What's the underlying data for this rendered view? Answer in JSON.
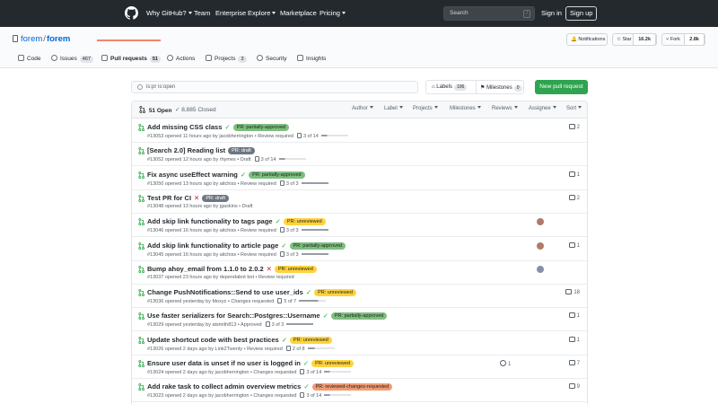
{
  "colors": {
    "header_bg": "#24292e",
    "accent": "#0366d6",
    "open_green": "#28a745",
    "new_pr_green": "#2ea44f",
    "fail_red": "#cb2431",
    "tab_underline": "#f9826c"
  },
  "header": {
    "logo_icon": "github-logo-icon",
    "nav": [
      "Why GitHub?",
      "Team",
      "Enterprise",
      "Explore",
      "Marketplace",
      "Pricing"
    ],
    "search_placeholder": "Search",
    "search_shortcut": "/",
    "sign_in": "Sign in",
    "sign_up": "Sign up"
  },
  "repo": {
    "owner": "forem",
    "separator": "/",
    "name": "forem",
    "notifications_label": "Notifications",
    "star_label": "Star",
    "star_count": "16.2k",
    "fork_label": "Fork",
    "fork_count": "2.8k"
  },
  "tabs": [
    {
      "label": "Code",
      "icon": "code-icon"
    },
    {
      "label": "Issues",
      "count": "467",
      "icon": "issue-icon"
    },
    {
      "label": "Pull requests",
      "count": "51",
      "icon": "pull-request-icon",
      "selected": true
    },
    {
      "label": "Actions",
      "icon": "play-icon"
    },
    {
      "label": "Projects",
      "count": "3",
      "icon": "project-icon"
    },
    {
      "label": "Security",
      "icon": "shield-icon"
    },
    {
      "label": "Insights",
      "icon": "graph-icon"
    }
  ],
  "toolbar": {
    "filter_value": "is:pr is:open",
    "labels_label": "Labels",
    "labels_count": "106",
    "milestones_label": "Milestones",
    "milestones_count": "0",
    "new_pr_label": "New pull request"
  },
  "list_header": {
    "open_label": "51 Open",
    "closed_label": "8,885 Closed",
    "filters": [
      "Author",
      "Label",
      "Projects",
      "Milestones",
      "Reviews",
      "Assignee",
      "Sort"
    ]
  },
  "label_colors": {
    "PR: partially-approved": {
      "bg": "#7dbf7d",
      "fg": "#1b1f23"
    },
    "PR: draft": {
      "bg": "#6e7781",
      "fg": "#ffffff"
    },
    "PR: unreviewed": {
      "bg": "#ffd33d",
      "fg": "#1b1f23"
    },
    "PR: reviewed-changes-requested": {
      "bg": "#f09b73",
      "fg": "#1b1f23"
    }
  },
  "pull_requests": [
    {
      "title": "Add missing CSS class",
      "status": "success",
      "label": "PR: partially-approved",
      "meta": "#13053 opened 11 hours ago by jacobherrington • Review required",
      "tasks": "3 of 14",
      "comments": "2"
    },
    {
      "title": "[Search 2.0] Reading list",
      "status": "none",
      "label": "PR: draft",
      "meta": "#13052 opened 12 hours ago by rhymes • Draft",
      "tasks": "3 of 14",
      "comments": ""
    },
    {
      "title": "Fix async useEffect warning",
      "status": "success",
      "label": "PR: partially-approved",
      "meta": "#13050 opened 13 hours ago by aitchiss • Review required",
      "tasks": "3 of 3",
      "comments": "1"
    },
    {
      "title": "Test PR for CI",
      "status": "fail",
      "label": "PR: draft",
      "meta": "#13048 opened 13 hours ago by jgaskins • Draft",
      "tasks": "",
      "comments": "2"
    },
    {
      "title": "Add skip link functionality to tags page",
      "status": "success",
      "label": "PR: unreviewed",
      "meta": "#13046 opened 16 hours ago by aitchiss • Review required",
      "tasks": "3 of 3",
      "comments": "",
      "avatar": "#b07a6a"
    },
    {
      "title": "Add skip link functionality to article page",
      "status": "success",
      "label": "PR: partially-approved",
      "meta": "#13045 opened 16 hours ago by aitchiss • Review required",
      "tasks": "3 of 3",
      "comments": "1",
      "avatar": "#b07a6a"
    },
    {
      "title": "Bump ahoy_email from 1.1.0 to 2.0.2",
      "status": "fail",
      "label": "PR: unreviewed",
      "meta": "#13037 opened 23 hours ago by dependabot  bot  • Review required",
      "tasks": "",
      "comments": "",
      "avatar": "#8a8fa8"
    },
    {
      "title": "Change PushNotifications::Send to use user_ids",
      "status": "success",
      "label": "PR: unreviewed",
      "meta": "#13036 opened yesterday by fdoxyz • Changes requested",
      "tasks": "5 of 7",
      "comments": "18"
    },
    {
      "title": "Use faster serializers for Search::Postgres::Username",
      "status": "success",
      "label": "PR: partially-approved",
      "meta": "#13029 opened yesterday by atsmith813 • Approved",
      "tasks": "3 of 3",
      "comments": "1"
    },
    {
      "title": "Update shortcut code with best practices",
      "status": "success",
      "label": "PR: unreviewed",
      "meta": "#13026 opened 2 days ago by Link2Twenty • Review required",
      "tasks": "2 of 8",
      "comments": "1"
    },
    {
      "title": "Ensure user data is unset if no user is logged in",
      "status": "success",
      "label": "PR: unreviewed",
      "meta": "#13024 opened 2 days ago by jacobherrington • Changes requested",
      "tasks": "3 of 14",
      "comments": "7",
      "linked": "1"
    },
    {
      "title": "Add rake task to collect admin overview metrics",
      "status": "success",
      "label": "PR: reviewed-changes-requested",
      "meta": "#13023 opened 2 days ago by jacobherrington • Changes requested",
      "tasks": "3 of 14",
      "comments": "9"
    }
  ]
}
